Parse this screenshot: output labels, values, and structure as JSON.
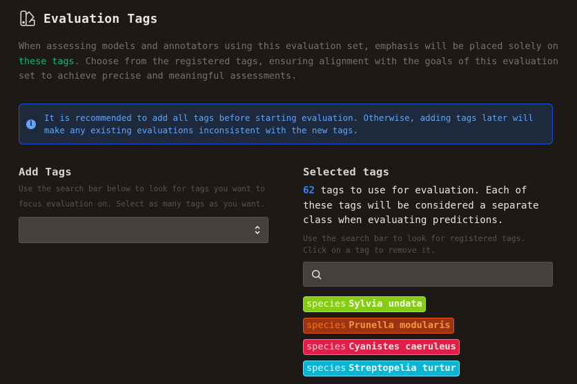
{
  "header": {
    "icon": "swatchbook-icon",
    "title": "Evaluation Tags"
  },
  "intro": {
    "before": "When assessing models and annotators using this evaluation set, emphasis will be placed solely on ",
    "highlight": "these tags",
    "after": ". Choose from the registered tags, ensuring alignment with the goals of this evaluation set to achieve precise and meaningful assessments."
  },
  "alert": {
    "icon": "info-icon",
    "message": "It is recommended to add all tags before starting evaluation. Otherwise, adding tags later will make any existing evaluations inconsistent with the new tags."
  },
  "add_tags": {
    "title": "Add Tags",
    "hint": "Use the search bar below to look for tags you want to focus evaluation on. Select as many tags as you want.",
    "select_value": ""
  },
  "selected_tags": {
    "title": "Selected tags",
    "count": "62",
    "summary": " tags to use for evaluation. Each of these tags will be considered a separate class when evaluating predictions.",
    "hint": "Use the search bar to look for registered tags. Click on a tag to remove it.",
    "search_value": "",
    "tags": [
      {
        "key": "species",
        "value": "Sylvia undata",
        "bg": "#84cc16",
        "border": "#a3e635",
        "keycolor": "#ecfccb",
        "valcolor": "#f7fee7"
      },
      {
        "key": "species",
        "value": "Prunella modularis",
        "bg": "#9a3412",
        "border": "#ea580c",
        "keycolor": "#f97316",
        "valcolor": "#fb923c"
      },
      {
        "key": "species",
        "value": "Cyanistes caeruleus",
        "bg": "#e11d48",
        "border": "#fb7185",
        "keycolor": "#fecdd3",
        "valcolor": "#ffe4e6"
      },
      {
        "key": "species",
        "value": "Streptopelia turtur",
        "bg": "#06b6d4",
        "border": "#67e8f9",
        "keycolor": "#cffafe",
        "valcolor": "#ecfeff"
      }
    ]
  }
}
